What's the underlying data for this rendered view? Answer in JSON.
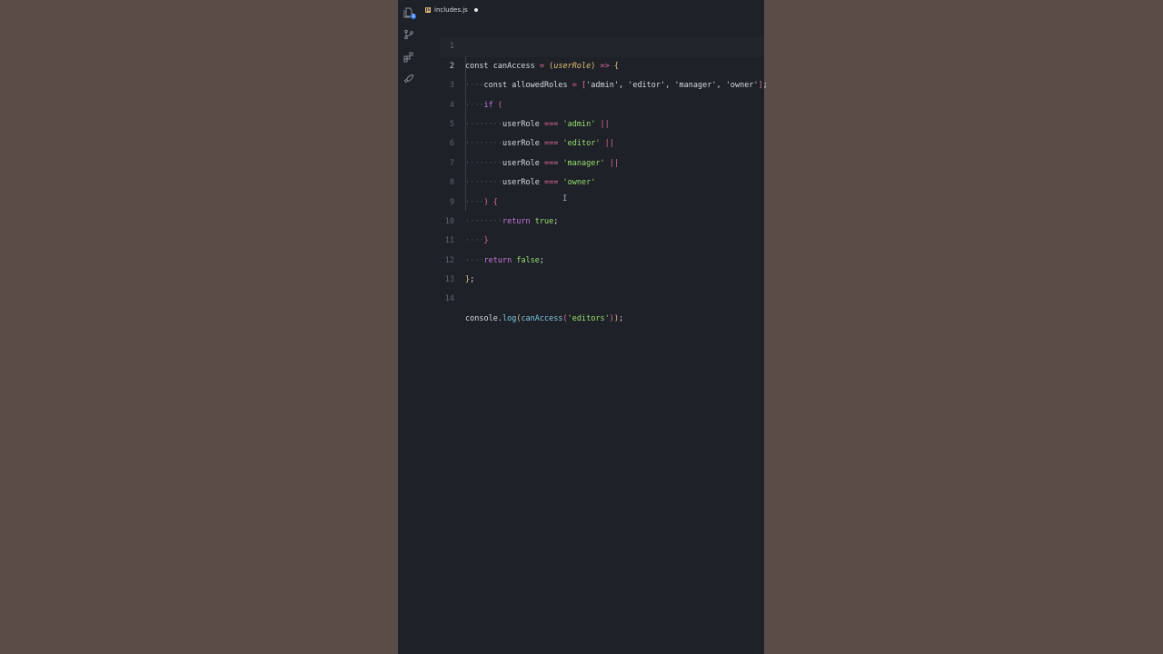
{
  "tab": {
    "filename": "includes.js",
    "badge": "1"
  },
  "activity_icons": [
    "files-icon",
    "source-control-icon",
    "extensions-icon",
    "rocket-icon"
  ],
  "code_lines": [
    {
      "n": "1"
    },
    {
      "n": "2"
    },
    {
      "n": "3"
    },
    {
      "n": "4"
    },
    {
      "n": "5"
    },
    {
      "n": "6"
    },
    {
      "n": "7"
    },
    {
      "n": "8"
    },
    {
      "n": "9"
    },
    {
      "n": "10"
    },
    {
      "n": "11"
    },
    {
      "n": "12"
    },
    {
      "n": "13"
    },
    {
      "n": "14"
    }
  ],
  "tokens": {
    "const": "const",
    "canAccess": "canAccess",
    "userRole_param": "userRole",
    "arrow": "=>",
    "allowedRoles": "allowedRoles",
    "s_admin": "'admin'",
    "s_editor": "'editor'",
    "s_manager": "'manager'",
    "s_owner": "'owner'",
    "if": "if",
    "userRole": "userRole",
    "eq": "===",
    "or": "||",
    "return": "return",
    "true": "true",
    "false": "false",
    "console": "console",
    "log": "log",
    "s_editors": "'editors'"
  },
  "colors": {
    "editor_bg": "#1e2127",
    "page_bg": "#5a4c46",
    "string": "#98e070",
    "operator": "#e06c9f",
    "keyword": "#c678dd"
  }
}
